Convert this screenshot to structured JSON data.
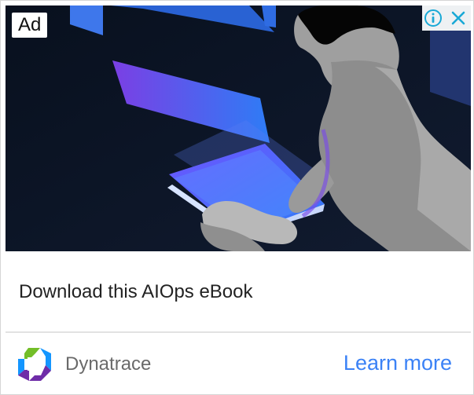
{
  "ad": {
    "badge": "Ad",
    "headline": "Download this AIOps eBook",
    "advertiser": "Dynatrace",
    "cta": "Learn more"
  },
  "icons": {
    "info": "info-icon",
    "close": "close-icon",
    "logo": "dynatrace-logo"
  },
  "colors": {
    "accent": "#3b82f6",
    "control_blue": "#19a9d6",
    "logo_green": "#73be28",
    "logo_blue": "#1496ff",
    "logo_purple": "#6f2da8",
    "scene_dark": "#0b1020"
  }
}
